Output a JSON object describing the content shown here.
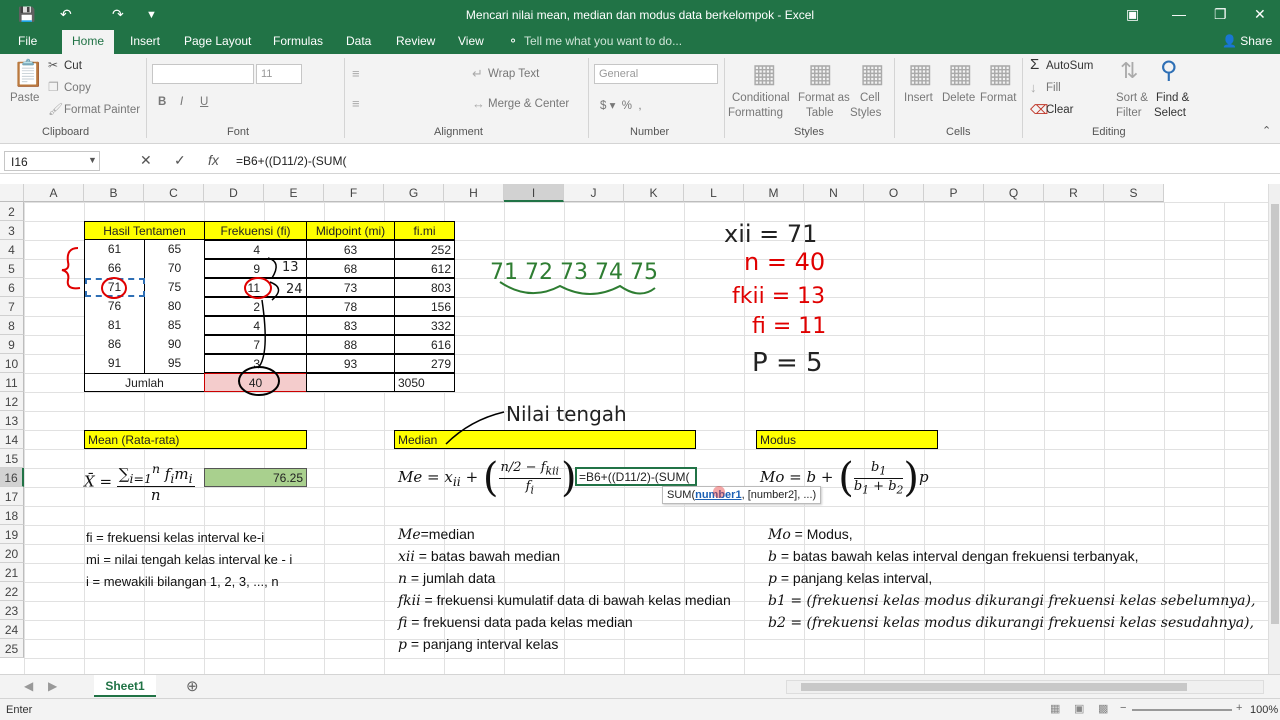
{
  "window": {
    "title": "Mencari nilai mean, median dan modus data berkelompok - Excel",
    "share_label": "Share",
    "tell_me": "Tell me what you want to do..."
  },
  "tabs": [
    "File",
    "Home",
    "Insert",
    "Page Layout",
    "Formulas",
    "Data",
    "Review",
    "View"
  ],
  "ribbon": {
    "clipboard": {
      "paste": "Paste",
      "cut": "Cut",
      "copy": "Copy",
      "format_painter": "Format Painter",
      "group": "Clipboard"
    },
    "font": {
      "size": "11",
      "group": "Font"
    },
    "alignment": {
      "wrap": "Wrap Text",
      "merge": "Merge & Center",
      "group": "Alignment"
    },
    "number": {
      "format": "General",
      "group": "Number"
    },
    "styles": {
      "cond1": "Conditional",
      "cond2": "Formatting",
      "fmt1": "Format as",
      "fmt2": "Table",
      "cell1": "Cell",
      "cell2": "Styles",
      "group": "Styles"
    },
    "cells": {
      "insert": "Insert",
      "delete": "Delete",
      "format": "Format",
      "group": "Cells"
    },
    "editing": {
      "autosum": "AutoSum",
      "fill": "Fill",
      "clear": "Clear",
      "sort1": "Sort &",
      "sort2": "Filter",
      "find1": "Find &",
      "find2": "Select",
      "group": "Editing"
    }
  },
  "formula_bar": {
    "name_box": "I16",
    "formula": "=B6+((D11/2)-(SUM("
  },
  "columns": [
    "A",
    "B",
    "C",
    "D",
    "E",
    "F",
    "G",
    "H",
    "I",
    "J",
    "K",
    "L",
    "M",
    "N",
    "O",
    "P",
    "Q",
    "R",
    "S"
  ],
  "rows": [
    "2",
    "3",
    "4",
    "5",
    "6",
    "7",
    "8",
    "9",
    "10",
    "11",
    "12",
    "13",
    "14",
    "15",
    "16",
    "17",
    "18",
    "19",
    "20",
    "21",
    "22",
    "23",
    "24",
    "25"
  ],
  "table": {
    "headers": [
      "Hasil Tentamen",
      "Frekuensi (fi)",
      "Midpoint (mi)",
      "fi.mi"
    ],
    "rows": [
      [
        "61",
        "65",
        "4",
        "63",
        "252"
      ],
      [
        "66",
        "70",
        "9",
        "68",
        "612"
      ],
      [
        "71",
        "75",
        "11",
        "73",
        "803"
      ],
      [
        "76",
        "80",
        "2",
        "78",
        "156"
      ],
      [
        "81",
        "85",
        "4",
        "83",
        "332"
      ],
      [
        "86",
        "90",
        "7",
        "88",
        "616"
      ],
      [
        "91",
        "95",
        "3",
        "93",
        "279"
      ]
    ],
    "total_label": "Jumlah",
    "total_freq": "40",
    "total_fimi": "3050"
  },
  "mean": {
    "header": "Mean (Rata-rata)",
    "value": "76.25"
  },
  "median": {
    "header": "Median",
    "editing_formula": "=B6+((D11/2)-(SUM(",
    "tooltip_fn": "SUM(",
    "tooltip_arg1": "number1",
    "tooltip_rest": ", [number2], ...)"
  },
  "modus": {
    "header": "Modus"
  },
  "mean_legend": [
    "fi = frekuensi kelas interval ke-i",
    "mi = nilai tengah kelas interval ke - i",
    "i = mewakili bilangan 1, 2, 3, ..., n"
  ],
  "median_legend": [
    {
      "sym": "Me",
      "text": "=median"
    },
    {
      "sym": "xii",
      "text": " = batas bawah median"
    },
    {
      "sym": "n",
      "text": " = jumlah data"
    },
    {
      "sym": "fkii",
      "text": " = frekuensi kumulatif data di bawah kelas median"
    },
    {
      "sym": "fi",
      "text": " = frekuensi data pada kelas median"
    },
    {
      "sym": "p",
      "text": " = panjang interval kelas"
    }
  ],
  "modus_legend": [
    {
      "sym": "Mo",
      "text": " = Modus,"
    },
    {
      "sym": "b",
      "text": " = batas bawah kelas interval dengan frekuensi terbanyak,"
    },
    {
      "sym": "p",
      "text": " = panjang kelas interval,"
    },
    {
      "sym": "b1",
      "text": " = (frekuensi kelas modus dikurangi frekuensi kelas sebelumnya),"
    },
    {
      "sym": "b2",
      "text": " = (frekuensi kelas modus dikurangi frekuensi kelas sesudahnya),"
    }
  ],
  "annotations": {
    "nilai_tengah": "Nilai tengah",
    "sequence": "71 72 73 74 75",
    "xii": "xii = 71",
    "n": "n = 40",
    "fkii": "fkii = 13",
    "fi": "fi = 11",
    "p": "P = 5",
    "note_13": "13",
    "note_24": "24"
  },
  "sheet": {
    "tab": "Sheet1"
  },
  "status": {
    "mode": "Enter",
    "zoom": "100%"
  },
  "colors": {
    "excel_green": "#217346",
    "yellow": "#ffff00",
    "mean_green": "#a9d08e",
    "pink": "#f4cccc",
    "ink_red": "#e00000",
    "ink_green": "#2e7d32"
  }
}
